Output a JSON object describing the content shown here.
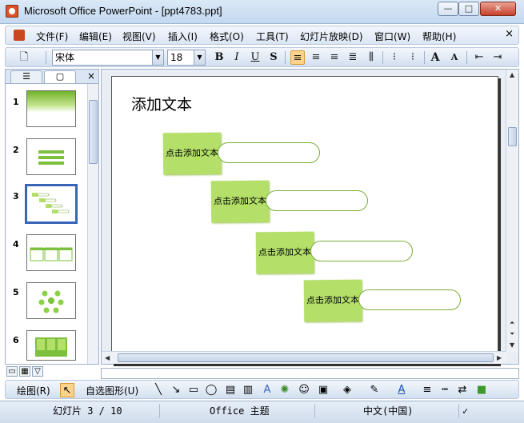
{
  "window": {
    "title": "Microsoft Office PowerPoint - [ppt4783.ppt]",
    "min_glyph": "—",
    "max_glyph": "□",
    "close_glyph": "✕"
  },
  "menu": {
    "items": [
      "文件(F)",
      "编辑(E)",
      "视图(V)",
      "插入(I)",
      "格式(O)",
      "工具(T)",
      "幻灯片放映(D)",
      "窗口(W)",
      "帮助(H)"
    ],
    "close_glyph": "×"
  },
  "toolbar": {
    "font_name": "宋体",
    "font_size": "18",
    "bold": "B",
    "italic": "I",
    "underline": "U",
    "shadow": "S",
    "grow_font": "A",
    "shrink_font": "A"
  },
  "slides_pane": {
    "numbers": [
      "1",
      "2",
      "3",
      "4",
      "5",
      "6"
    ],
    "selected": 3,
    "close_glyph": "×"
  },
  "slide": {
    "title": "添加文本",
    "boxes": [
      "点击添加文本",
      "点击添加文本",
      "点击添加文本",
      "点击添加文本"
    ]
  },
  "drawing": {
    "draw_label": "绘图(R)",
    "autoshape_label": "自选图形(U)"
  },
  "status": {
    "slide_info": "幻灯片 3 / 10",
    "theme": "Office 主题",
    "language": "中文(中国)"
  },
  "colors": {
    "accent_green": "#b4e06a",
    "pill_stroke": "#79ad37",
    "selection": "#3a64b8"
  }
}
